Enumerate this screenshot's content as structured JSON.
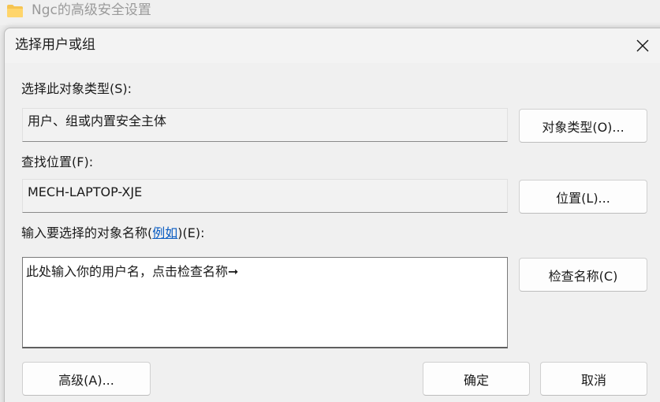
{
  "parent_window": {
    "title": "Ngc的高级安全设置",
    "icon": "folder-icon"
  },
  "dialog": {
    "title": "选择用户或组",
    "close_icon": "close-icon",
    "object_type": {
      "label": "选择此对象类型(S):",
      "value": "用户、组或内置安全主体",
      "button": "对象类型(O)..."
    },
    "location": {
      "label": "查找位置(F):",
      "value": "MECH-LAPTOP-XJE",
      "button": "位置(L)..."
    },
    "names": {
      "label_prefix": "输入要选择的对象名称(",
      "label_link": "例如",
      "label_suffix": ")(E):",
      "value": "此处输入你的用户名，点击检查名称➞",
      "check_button": "检查名称(C)"
    },
    "advanced_button": "高级(A)...",
    "ok_button": "确定",
    "cancel_button": "取消"
  }
}
